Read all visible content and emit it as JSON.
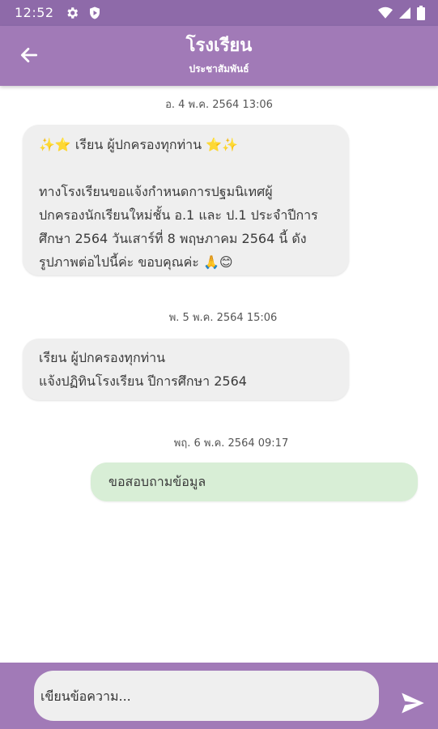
{
  "status_bar": {
    "time": "12:52",
    "icons": [
      "gear-icon",
      "shield-play-icon",
      "wifi-icon",
      "signal-icon",
      "battery-icon"
    ]
  },
  "header": {
    "title": "โรงเรียน",
    "subtitle": "ประชาสัมพันธ์",
    "back_icon": "arrow-left-icon",
    "background": "#a17ab7"
  },
  "messages": [
    {
      "timestamp": "อ. 4 พ.ค. 2564 13:06",
      "direction": "incoming",
      "lines": [
        "✨⭐ เรียน ผู้ปกครองทุกท่าน ⭐✨",
        "",
        "ทางโรงเรียนขอแจ้งกำหนดการปฐมนิเทศผู้",
        "ปกครองนักเรียนใหม่ชั้น อ.1 และ ป.1 ประจำปีการ",
        "ศึกษา 2564 วันเสาร์ที่ 8 พฤษภาคม 2564 นี้ ดัง",
        "รูปภาพต่อไปนี้ค่ะ ขอบคุณค่ะ 🙏😊"
      ]
    },
    {
      "timestamp": "พ. 5 พ.ค. 2564 15:06",
      "direction": "incoming",
      "lines": [
        "เรียน ผู้ปกครองทุกท่าน",
        "แจ้งปฏิทินโรงเรียน ปีการศึกษา 2564"
      ]
    },
    {
      "timestamp": "พฤ. 6 พ.ค. 2564 09:17",
      "direction": "outgoing",
      "lines": [
        "ขอสอบถามข้อมูล"
      ]
    }
  ],
  "composer": {
    "placeholder": "เขียนข้อความ...",
    "send_icon": "send-icon"
  },
  "colors": {
    "incoming_bubble": "#efefef",
    "outgoing_bubble": "#d8eed6",
    "status_bar": "#8e6aa9"
  }
}
